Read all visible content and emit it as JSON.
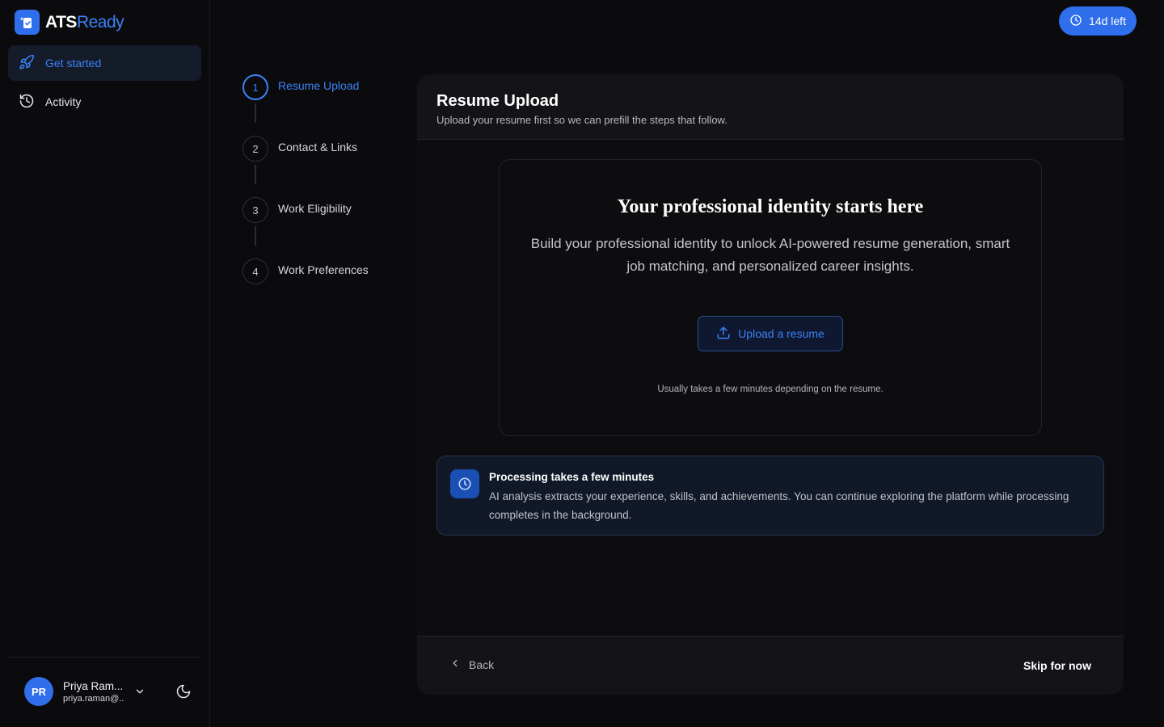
{
  "app": {
    "brand_primary": "ATS",
    "brand_accent": "Ready",
    "accent_color": "#3b82f6"
  },
  "sidebar": {
    "items": [
      {
        "label": "Get started",
        "icon": "rocket-icon",
        "active": true
      },
      {
        "label": "Activity",
        "icon": "history-icon",
        "active": false
      }
    ],
    "user": {
      "initials": "PR",
      "name": "Priya Ram...",
      "email": "priya.raman@..."
    }
  },
  "header": {
    "trial_label": "14d left"
  },
  "stepper": {
    "steps": [
      {
        "number": "1",
        "label": "Resume Upload",
        "active": true
      },
      {
        "number": "2",
        "label": "Contact & Links",
        "active": false
      },
      {
        "number": "3",
        "label": "Work Eligibility",
        "active": false
      },
      {
        "number": "4",
        "label": "Work Preferences",
        "active": false
      }
    ]
  },
  "card": {
    "title": "Resume Upload",
    "subtitle": "Upload your resume first so we can prefill the steps that follow.",
    "hero_title": "Your professional identity starts here",
    "hero_text": "Build your professional identity to unlock AI-powered resume generation, smart job matching, and personalized career insights.",
    "upload_button": "Upload a resume",
    "upload_hint": "Usually takes a few minutes depending on the resume.",
    "info_title": "Processing takes a few minutes",
    "info_text": "AI analysis extracts your experience, skills, and achievements. You can continue exploring the platform while processing completes in the background.",
    "back_label": "Back",
    "skip_label": "Skip for now"
  }
}
